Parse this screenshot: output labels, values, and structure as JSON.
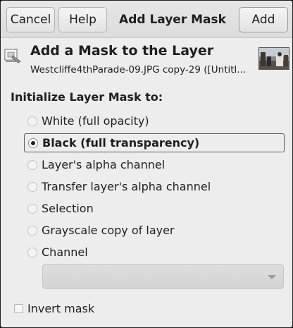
{
  "header": {
    "cancel_label": "Cancel",
    "help_label": "Help",
    "title": "Add Layer Mask",
    "add_label": "Add"
  },
  "dialog": {
    "icon": "layer-mask-icon",
    "title": "Add a Mask to the Layer",
    "subtitle": "Westcliffe4thParade-09.JPG copy-29 ([Untitl...",
    "thumbnail": "image-thumbnail"
  },
  "init_mask": {
    "label": "Initialize Layer Mask to:",
    "selected": "Black (full transparency)",
    "options": [
      {
        "label": "White (full opacity)",
        "checked": false
      },
      {
        "label": "Black (full transparency)",
        "checked": true
      },
      {
        "label": "Layer's alpha channel",
        "checked": false
      },
      {
        "label": "Transfer layer's alpha channel",
        "checked": false
      },
      {
        "label": "Selection",
        "checked": false
      },
      {
        "label": "Grayscale copy of layer",
        "checked": false
      },
      {
        "label": "Channel",
        "checked": false
      }
    ],
    "channel_combo": {
      "value": "",
      "icon": "chevron-down-icon"
    }
  },
  "invert": {
    "label": "Invert mask",
    "checked": false
  }
}
